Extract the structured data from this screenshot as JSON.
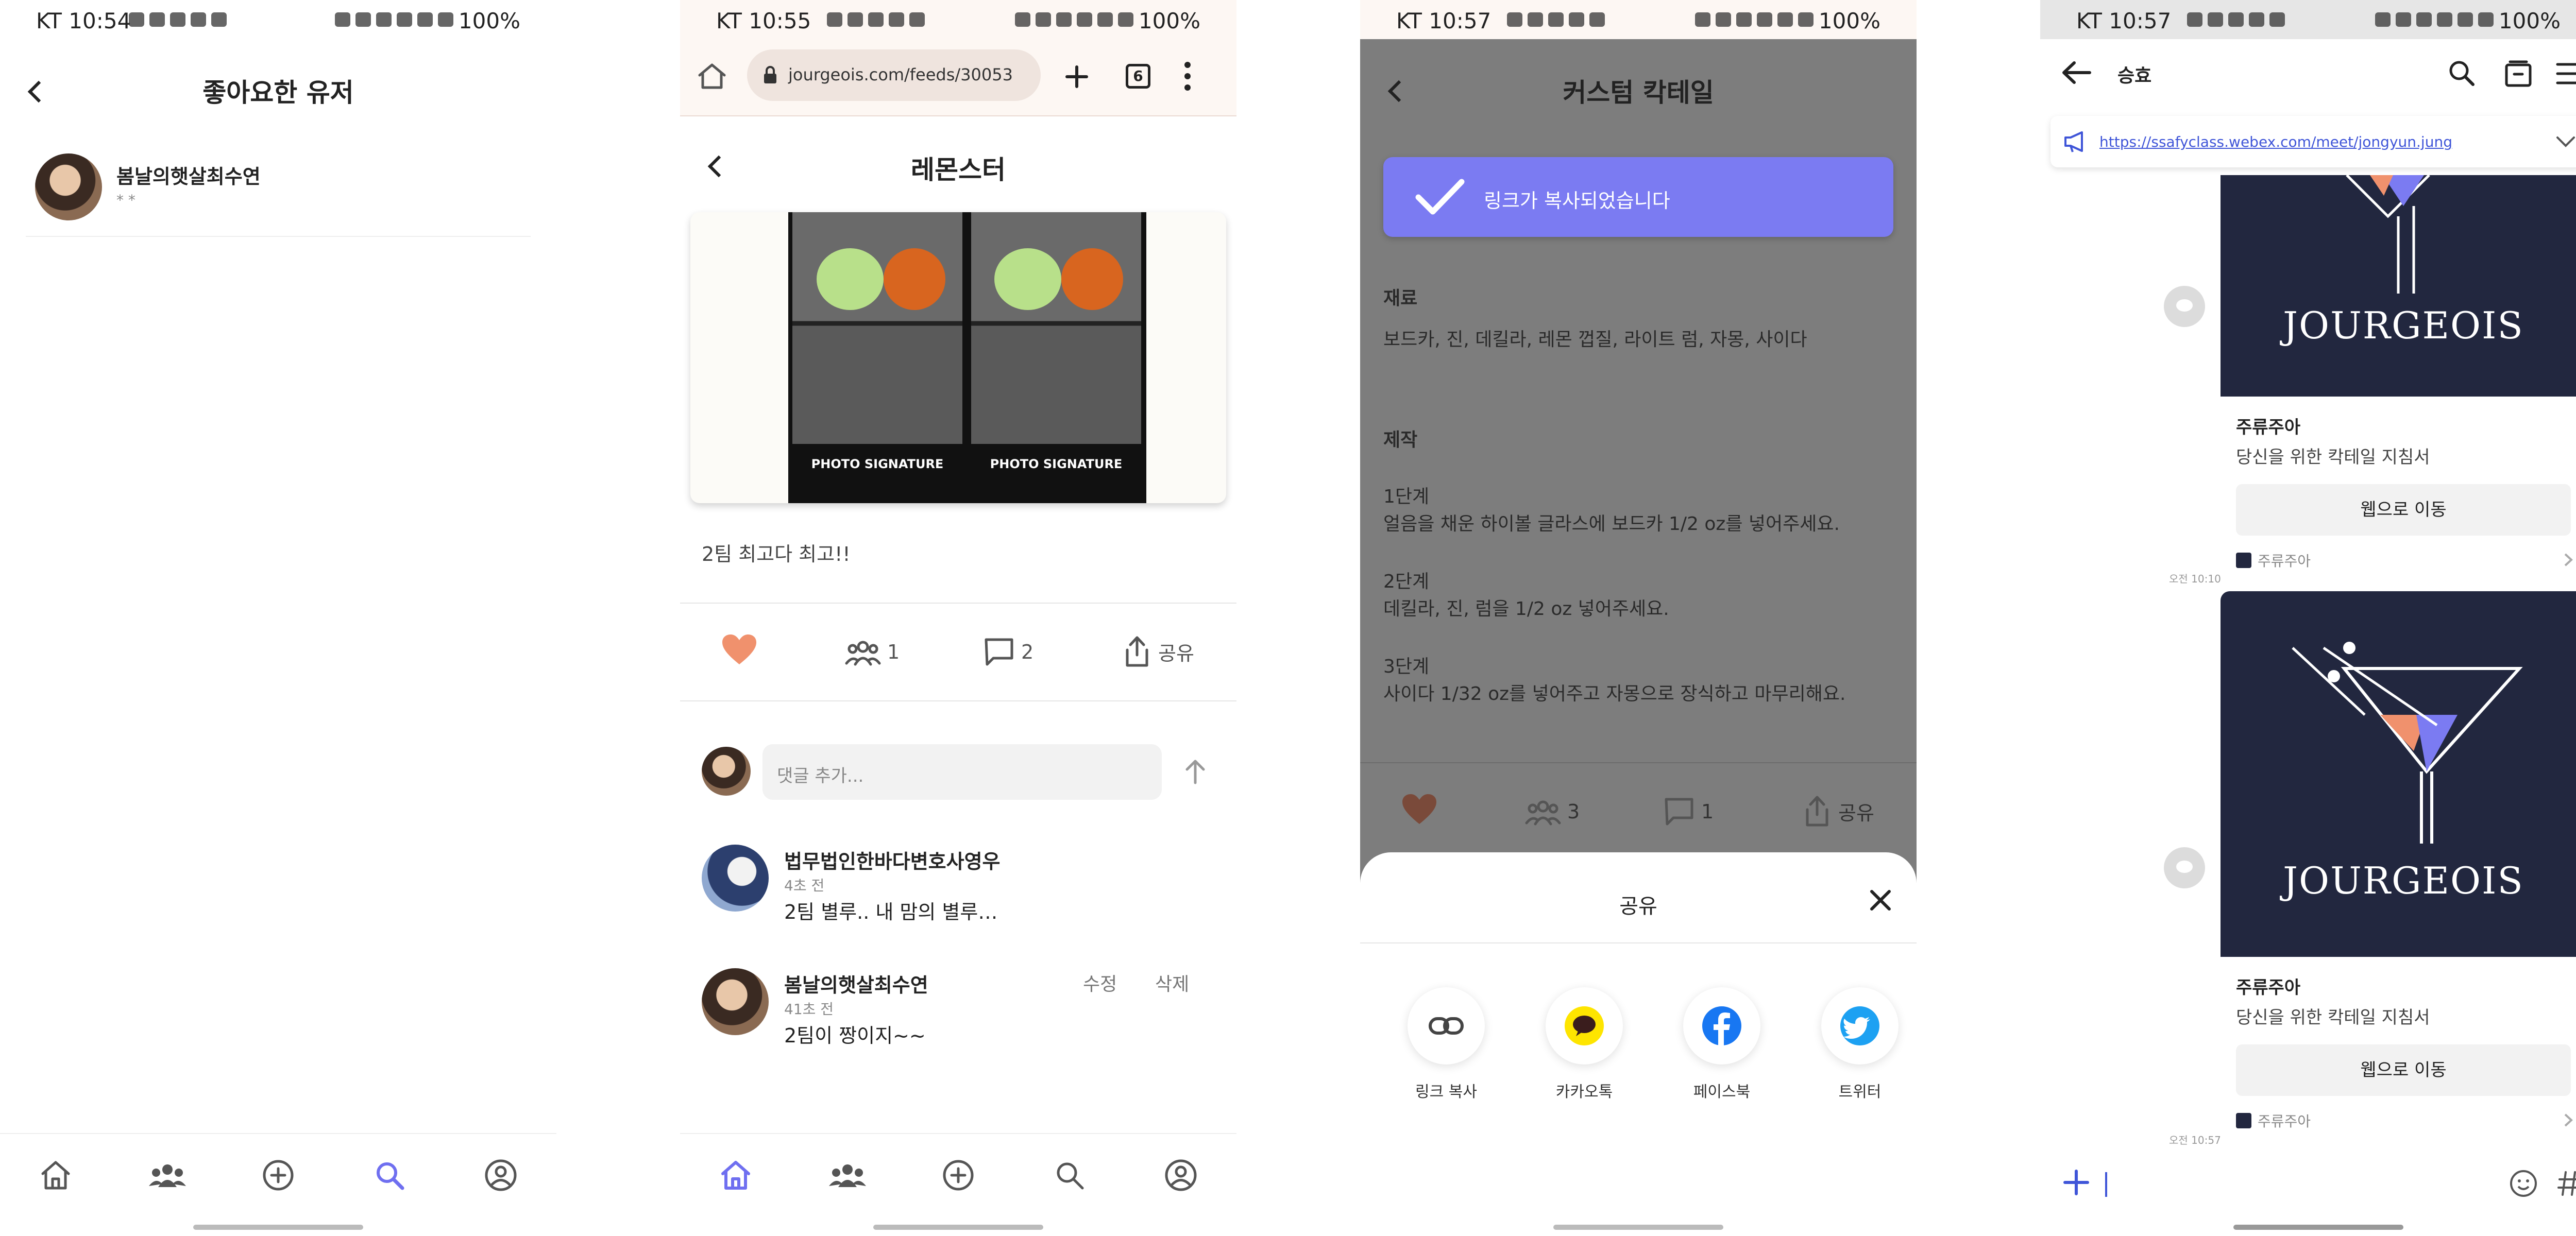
{
  "colors": {
    "accent": "#6F6FF0",
    "heart": "#F0916D",
    "navy": "#22273F",
    "link": "#3F55D8"
  },
  "screen1": {
    "status": {
      "time": "KT 10:54",
      "battery": "100%"
    },
    "header": {
      "title": "좋아요한 유저"
    },
    "users": [
      {
        "name": "봄날의햇살최수연",
        "sub": "* *"
      }
    ],
    "nav": [
      "home-icon",
      "people-icon",
      "plus-icon",
      "search-icon",
      "profile-icon"
    ]
  },
  "screen2": {
    "status": {
      "time": "KT 10:55",
      "battery": "100%"
    },
    "browser": {
      "url": "jourgeois.com/feeds/30053",
      "tab_count": "6"
    },
    "header": {
      "title": "레몬스터"
    },
    "photo": {
      "caption_left": "PHOTO SIGNATURE",
      "caption_right": "PHOTO SIGNATURE"
    },
    "post_text": "2팀 최고다 최고!!",
    "actions": {
      "likes_icon": "heart-icon",
      "participants": "1",
      "comments": "2",
      "share": "공유"
    },
    "comment_input": {
      "placeholder": "댓글 추가..."
    },
    "comments": [
      {
        "name": "법무법인한바다변호사영우",
        "time": "4초 전",
        "text": "2팀 별루.. 내 맘의 별루…"
      },
      {
        "name": "봄날의햇살최수연",
        "time": "41초 전",
        "text": "2팀이 짱이지~~",
        "edit": "수정",
        "delete": "삭제"
      }
    ]
  },
  "screen3": {
    "status": {
      "time": "KT 10:57",
      "battery": "100%"
    },
    "header": {
      "title": "커스텀 칵테일"
    },
    "toast": "링크가 복사되었습니다",
    "ingredients_title": "재료",
    "ingredients": "보드카, 진, 데킬라, 레몬 껍질, 라이트 럼, 자몽, 사이다",
    "steps_title": "제작",
    "steps": [
      {
        "label": "1단계",
        "text": "얼음을 채운 하이볼 글라스에 보드카 1/2 oz를 넣어주세요."
      },
      {
        "label": "2단계",
        "text": "데킬라, 진, 럼을 1/2 oz 넣어주세요."
      },
      {
        "label": "3단계",
        "text": "사이다 1/32 oz를 넣어주고 자몽으로 장식하고 마무리해요."
      }
    ],
    "actions": {
      "participants": "3",
      "comments": "1",
      "share": "공유"
    },
    "share_sheet": {
      "title": "공유",
      "options": [
        {
          "label": "링크 복사",
          "icon": "link-icon"
        },
        {
          "label": "카카오톡",
          "icon": "kakaotalk-icon"
        },
        {
          "label": "페이스북",
          "icon": "facebook-icon"
        },
        {
          "label": "트위터",
          "icon": "twitter-icon"
        }
      ]
    }
  },
  "screen4": {
    "status": {
      "time": "KT 10:57",
      "battery": "100%"
    },
    "header": {
      "title": "승효"
    },
    "notice_link": "https://ssafyclass.webex.com/meet/jongyun.jung",
    "cards": [
      {
        "brand": "JOURGEOIS",
        "title": "주류주아",
        "desc": "당신을 위한 칵테일 지침서",
        "button": "웹으로 이동",
        "source": "주류주아",
        "time": "오전 10:10"
      },
      {
        "brand": "JOURGEOIS",
        "title": "주류주아",
        "desc": "당신을 위한 칵테일 지침서",
        "button": "웹으로 이동",
        "source": "주류주아",
        "time": "오전 10:57"
      }
    ]
  }
}
